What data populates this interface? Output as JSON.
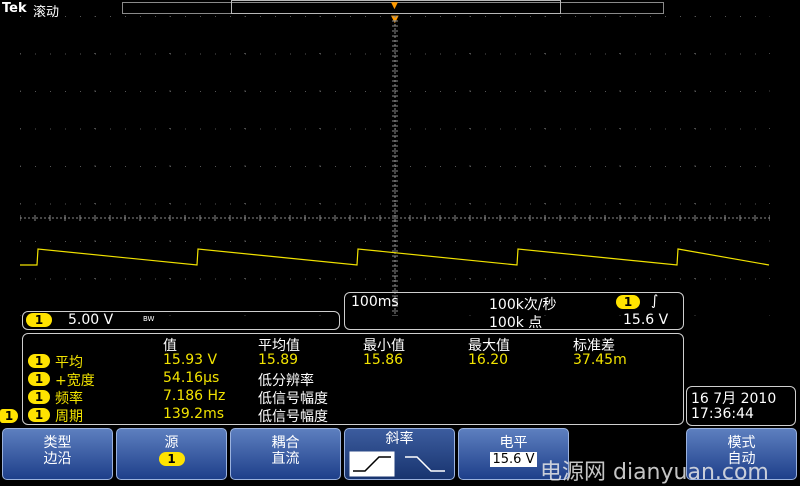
{
  "top_bar": {
    "brand": "Tek",
    "mode": "滚动"
  },
  "colors": {
    "ch1": "#f2e300",
    "trigger": "#ff9a00",
    "menu": "#2c4f9a",
    "graticule": "#8a8a8a"
  },
  "channel": {
    "badge": "1",
    "scale": "5.00 V",
    "bw_icon": "BW"
  },
  "timebase": {
    "time_per_div": "100ms",
    "sample_rate": "100k次/秒",
    "record_length": "100k 点",
    "trigger_badge": "1",
    "trigger_slope_icon": "rising-edge-icon",
    "trigger_level": "15.6 V"
  },
  "measurements": {
    "headers": [
      "值",
      "平均值",
      "最小值",
      "最大值",
      "标准差"
    ],
    "rows": [
      {
        "badge": "1",
        "name": "平均",
        "value": "15.93 V",
        "mean": "15.89",
        "min": "15.86",
        "max": "16.20",
        "std": "37.45m"
      },
      {
        "badge": "1",
        "name": "+宽度",
        "value": "54.16μs",
        "mean": "低分辨率",
        "min": "",
        "max": "",
        "std": ""
      },
      {
        "badge": "1",
        "name": "频率",
        "value": "7.186 Hz",
        "mean": "低信号幅度",
        "min": "",
        "max": "",
        "std": ""
      },
      {
        "badge": "1",
        "name": "周期",
        "value": "139.2ms",
        "mean": "低信号幅度",
        "min": "",
        "max": "",
        "std": ""
      }
    ]
  },
  "ground_marker": "1",
  "datetime": {
    "date": "16 7月  2010",
    "time": "17:36:44"
  },
  "menu": {
    "type_label": "类型",
    "type_value": "边沿",
    "source_label": "源",
    "source_value": "1",
    "coupling_label": "耦合",
    "coupling_value": "直流",
    "slope_label": "斜率",
    "level_label": "电平",
    "level_value": "15.6 V",
    "mode_label": "模式",
    "mode_value": "自动"
  },
  "watermark": "电源网 dianyuan.com"
}
